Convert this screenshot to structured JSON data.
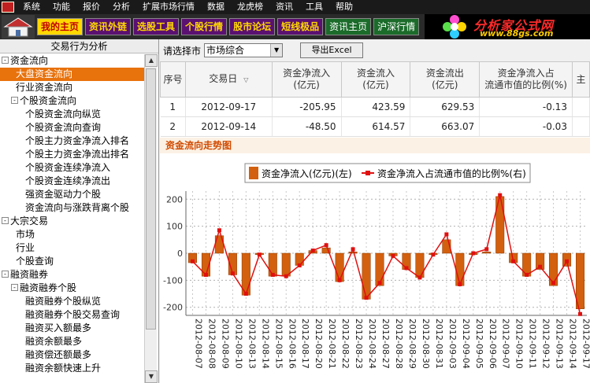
{
  "menubar": {
    "items": [
      "系统",
      "功能",
      "报价",
      "分析",
      "扩展市场行情",
      "数据",
      "龙虎榜",
      "资讯",
      "工具",
      "帮助"
    ]
  },
  "toolbar": {
    "buttons": [
      "我的主页",
      "资讯外链",
      "选股工具",
      "个股行情",
      "股市论坛",
      "短线极品"
    ],
    "right_buttons": [
      "资讯主页",
      "沪深行情"
    ],
    "brand_title": "分析家公式网",
    "brand_url": "www.88gs.com"
  },
  "sidebar": {
    "title": "交易行为分析",
    "tree": [
      {
        "label": "资金流向",
        "level": 0,
        "toggle": "-"
      },
      {
        "label": "大盘资金流向",
        "level": 1,
        "selected": true
      },
      {
        "label": "行业资金流向",
        "level": 1
      },
      {
        "label": "个股资金流向",
        "level": 1,
        "toggle": "-"
      },
      {
        "label": "个股资金流向纵览",
        "level": 2
      },
      {
        "label": "个股资金流向查询",
        "level": 2
      },
      {
        "label": "个股主力资金净流入排名",
        "level": 2
      },
      {
        "label": "个股主力资金净流出排名",
        "level": 2
      },
      {
        "label": "个股资金连续净流入",
        "level": 2
      },
      {
        "label": "个股资金连续净流出",
        "level": 2
      },
      {
        "label": "强资金驱动力个股",
        "level": 2
      },
      {
        "label": "资金流向与涨跌背离个股",
        "level": 2
      },
      {
        "label": "大宗交易",
        "level": 0,
        "toggle": "-"
      },
      {
        "label": "市场",
        "level": 1
      },
      {
        "label": "行业",
        "level": 1
      },
      {
        "label": "个股查询",
        "level": 1
      },
      {
        "label": "融资融券",
        "level": 0,
        "toggle": "-"
      },
      {
        "label": "融资融券个股",
        "level": 1,
        "toggle": "-"
      },
      {
        "label": "融资融券个股纵览",
        "level": 2
      },
      {
        "label": "融资融券个股交易查询",
        "level": 2
      },
      {
        "label": "融资买入额最多",
        "level": 2
      },
      {
        "label": "融资余额最多",
        "level": 2
      },
      {
        "label": "融资偿还额最多",
        "level": 2
      },
      {
        "label": "融资余额快速上升",
        "level": 2
      }
    ]
  },
  "main": {
    "market_label": "请选择市",
    "market_value": "市场综合",
    "export_label": "导出Excel",
    "columns": [
      "序号",
      "交易日",
      "资金净流入\n(亿元)",
      "资金流入\n(亿元)",
      "资金流出\n(亿元)",
      "资金净流入占\n流通市值的比例(%)",
      "主"
    ],
    "rows": [
      [
        "1",
        "2012-09-17",
        "-205.95",
        "423.59",
        "629.53",
        "-0.13",
        ""
      ],
      [
        "2",
        "2012-09-14",
        "-48.50",
        "614.57",
        "663.07",
        "-0.03",
        ""
      ]
    ],
    "trend_title": "资金流向走势图"
  },
  "colors": {
    "bar": "#d2600e",
    "line": "#e01010",
    "selected": "#e8720c"
  },
  "chart_data": {
    "type": "bar",
    "legend": [
      "资金净流入(亿元)(左)",
      "资金净流入占流通市值的比例%(右)"
    ],
    "ylim": [
      -230,
      230
    ],
    "yticks": [
      200,
      100,
      0,
      -100,
      -200
    ],
    "categories": [
      "2012-08-07",
      "2012-08-08",
      "2012-08-09",
      "2012-08-10",
      "2012-08-13",
      "2012-08-14",
      "2012-08-15",
      "2012-08-16",
      "2012-08-17",
      "2012-08-20",
      "2012-08-21",
      "2012-08-22",
      "2012-08-23",
      "2012-08-24",
      "2012-08-27",
      "2012-08-28",
      "2012-08-29",
      "2012-08-30",
      "2012-08-31",
      "2012-09-03",
      "2012-09-04",
      "2012-09-05",
      "2012-09-06",
      "2012-09-07",
      "2012-09-10",
      "2012-09-11",
      "2012-09-12",
      "2012-09-13",
      "2012-09-14",
      "2012-09-17"
    ],
    "series": [
      {
        "name": "资金净流入(亿元)(左)",
        "type": "bar",
        "values": [
          -35,
          -85,
          65,
          -80,
          -155,
          -5,
          -85,
          -85,
          -45,
          10,
          20,
          -105,
          5,
          -170,
          -120,
          -10,
          -60,
          -90,
          -5,
          50,
          -120,
          -5,
          5,
          210,
          -35,
          -85,
          -60,
          -120,
          -48,
          -206
        ]
      },
      {
        "name": "资金净流入占流通市值的比例%(右)",
        "type": "line",
        "values": [
          -30,
          -80,
          85,
          -75,
          -150,
          -5,
          -80,
          -85,
          -45,
          10,
          30,
          -100,
          15,
          -165,
          -110,
          -10,
          -55,
          -90,
          -5,
          70,
          -115,
          0,
          15,
          215,
          -30,
          -80,
          -50,
          -110,
          -30,
          -225
        ]
      }
    ]
  }
}
